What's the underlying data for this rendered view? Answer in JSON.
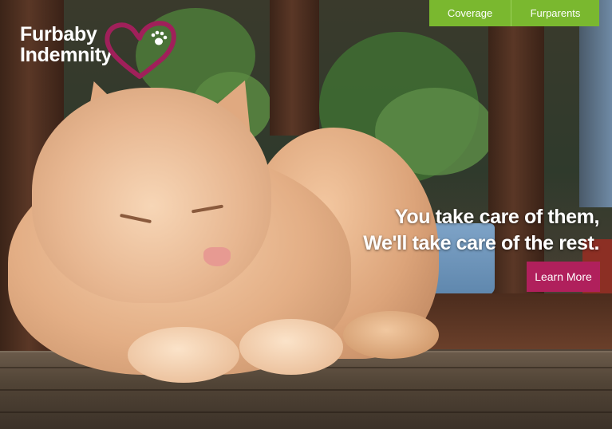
{
  "brand": {
    "name_line1": "Furbaby",
    "name_line2": "Indemnity",
    "heart_color": "#a0205a",
    "paw_icon": "paw-icon"
  },
  "nav": {
    "items": [
      {
        "label": "Coverage"
      },
      {
        "label": "Furparents"
      }
    ],
    "color": "#7ab82f"
  },
  "hero": {
    "line1": "You take care of them,",
    "line2": "We'll take care of the rest.",
    "cta_label": "Learn More",
    "cta_color": "#b0205c"
  }
}
